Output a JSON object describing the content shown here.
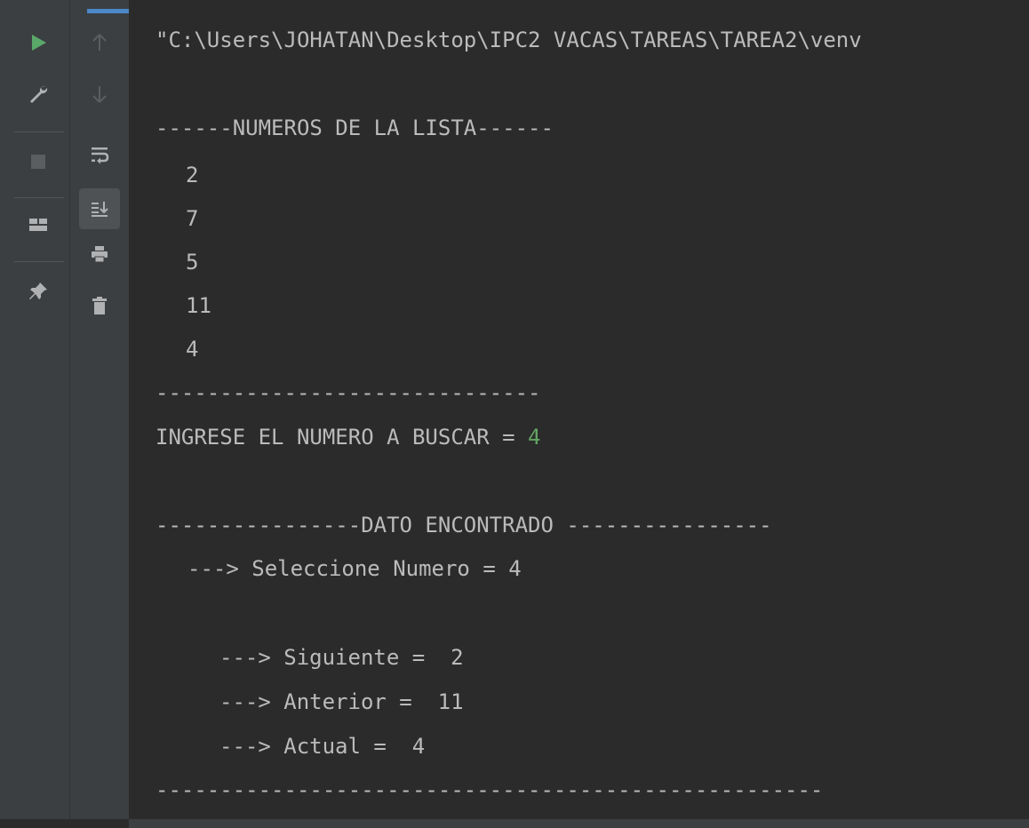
{
  "toolbar": {
    "left": [
      {
        "icon": "run-icon",
        "color": "#59a869"
      },
      {
        "icon": "wrench-icon",
        "color": "#afb1b3"
      },
      {
        "icon": "stop-icon",
        "color": "#5b5e60"
      },
      {
        "icon": "layout-icon",
        "color": "#afb1b3"
      },
      {
        "icon": "pin-icon",
        "color": "#afb1b3"
      }
    ],
    "right": [
      {
        "icon": "arrow-up-icon",
        "color": "#5b5e60"
      },
      {
        "icon": "arrow-down-icon",
        "color": "#5b5e60"
      },
      {
        "icon": "soft-wrap-icon",
        "color": "#afb1b3"
      },
      {
        "icon": "scroll-to-end-icon",
        "color": "#afb1b3",
        "active": true
      },
      {
        "icon": "print-icon",
        "color": "#afb1b3"
      },
      {
        "icon": "trash-icon",
        "color": "#afb1b3"
      }
    ]
  },
  "console": {
    "command_line": "\"C:\\Users\\JOHATAN\\Desktop\\IPC2 VACAS\\TAREAS\\TAREA2\\venv",
    "list_header": "------NUMEROS DE LA LISTA------",
    "numbers": [
      "2",
      "7",
      "5",
      "11",
      "4"
    ],
    "list_footer": "------------------------------",
    "prompt": "INGRESE EL NUMERO A BUSCAR = ",
    "input_value": "4",
    "found_header": "----------------DATO ENCONTRADO ----------------",
    "selected": "---> Seleccione Numero = 4",
    "next": "---> Siguiente =  2",
    "previous": "---> Anterior =  11",
    "current": "---> Actual =  4",
    "closing": "----------------------------------------------------"
  },
  "colors": {
    "background": "#2b2b2b",
    "toolbar": "#3c3f41",
    "text": "#bbbbbb",
    "input": "#62a362",
    "accent": "#4a88c7"
  }
}
